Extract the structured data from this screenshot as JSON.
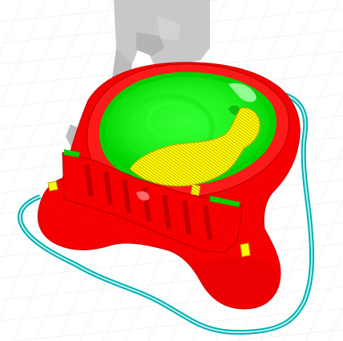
{
  "viewport": {
    "label": "",
    "background": "#ffffff"
  },
  "colors": {
    "bed_grid": "#e6e6e6",
    "ghost_model": "#c8c8c8",
    "ghost_model_dark": "#b4b4b4",
    "perimeter_outer": "#ff0000",
    "perimeter_shade": "#c80000",
    "inner_wall": "#00e000",
    "top_solid_infill": "#ffff00",
    "infill_lines": "#b8a400",
    "skirt": "#00b0b0",
    "skirt_inner": "#9ae6ea"
  },
  "objects": [
    {
      "name": "sliced-model",
      "feature_types": [
        "perimeter",
        "external-perimeter",
        "top-solid-infill",
        "skirt"
      ]
    },
    {
      "name": "ghost-model"
    }
  ]
}
